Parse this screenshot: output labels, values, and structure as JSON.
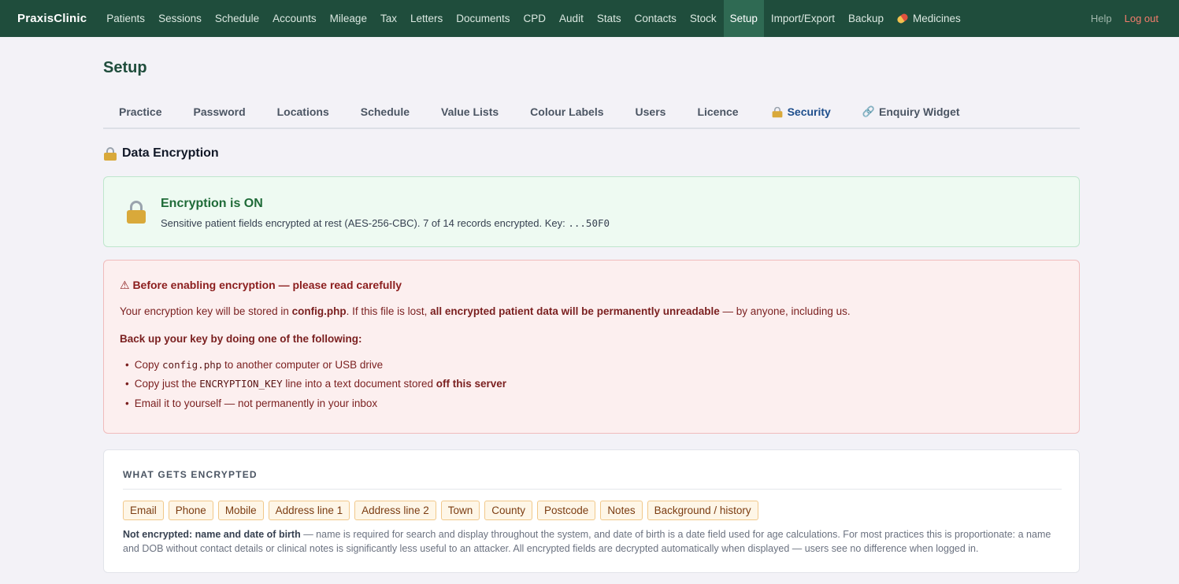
{
  "app": {
    "brand": "PraxisClinic",
    "nav": [
      {
        "label": "Patients"
      },
      {
        "label": "Sessions"
      },
      {
        "label": "Schedule"
      },
      {
        "label": "Accounts"
      },
      {
        "label": "Mileage"
      },
      {
        "label": "Tax"
      },
      {
        "label": "Letters"
      },
      {
        "label": "Documents"
      },
      {
        "label": "CPD"
      },
      {
        "label": "Audit"
      },
      {
        "label": "Stats"
      },
      {
        "label": "Contacts"
      },
      {
        "label": "Stock"
      },
      {
        "label": "Setup",
        "active": true
      },
      {
        "label": "Import/Export"
      },
      {
        "label": "Backup"
      },
      {
        "label": "Medicines",
        "icon": "pill-icon"
      }
    ],
    "help_label": "Help",
    "logout_label": "Log out",
    "colors": {
      "nav_bg": "#1f4d3c",
      "nav_active": "#2f6a53",
      "logout": "#f47c6c"
    }
  },
  "page": {
    "title": "Setup",
    "tabs": [
      {
        "label": "Practice"
      },
      {
        "label": "Password"
      },
      {
        "label": "Locations"
      },
      {
        "label": "Schedule"
      },
      {
        "label": "Value Lists"
      },
      {
        "label": "Colour Labels"
      },
      {
        "label": "Users"
      },
      {
        "label": "Licence"
      },
      {
        "label": "Security",
        "icon": "lock-icon",
        "active": true
      },
      {
        "label": "Enquiry Widget",
        "icon": "link-icon"
      }
    ]
  },
  "encryption": {
    "heading": "Data Encryption",
    "status_title": "Encryption is ON",
    "status_text": "Sensitive patient fields encrypted at rest (AES-256-CBC). 7 of 14 records encrypted. Key: ",
    "status_key": "...50F0",
    "warning": {
      "title": "⚠ Before enabling encryption — please read carefully",
      "line1_pre": "Your encryption key will be stored in ",
      "line1_file": "config.php",
      "line1_mid": ". If this file is lost, ",
      "line1_bold": "all encrypted patient data will be permanently unreadable",
      "line1_post": " — by anyone, including us.",
      "subtitle": "Back up your key by doing one of the following:",
      "item1_pre": "Copy ",
      "item1_code": "config.php",
      "item1_post": " to another computer or USB drive",
      "item2_pre": "Copy just the ",
      "item2_code": "ENCRYPTION_KEY",
      "item2_mid": " line into a text document stored ",
      "item2_bold": "off this server",
      "item3": "Email it to yourself — not permanently in your inbox"
    },
    "what": {
      "title": "WHAT GETS ENCRYPTED",
      "fields": [
        "Email",
        "Phone",
        "Mobile",
        "Address line 1",
        "Address line 2",
        "Town",
        "County",
        "Postcode",
        "Notes",
        "Background / history"
      ],
      "note_bold": "Not encrypted: name and date of birth",
      "note_text": " — name is required for search and display throughout the system, and date of birth is a date field used for age calculations. For most practices this is proportionate: a name and DOB without contact details or clinical notes is significantly less useful to an attacker. All encrypted fields are decrypted automatically when displayed — users see no difference when logged in."
    }
  }
}
